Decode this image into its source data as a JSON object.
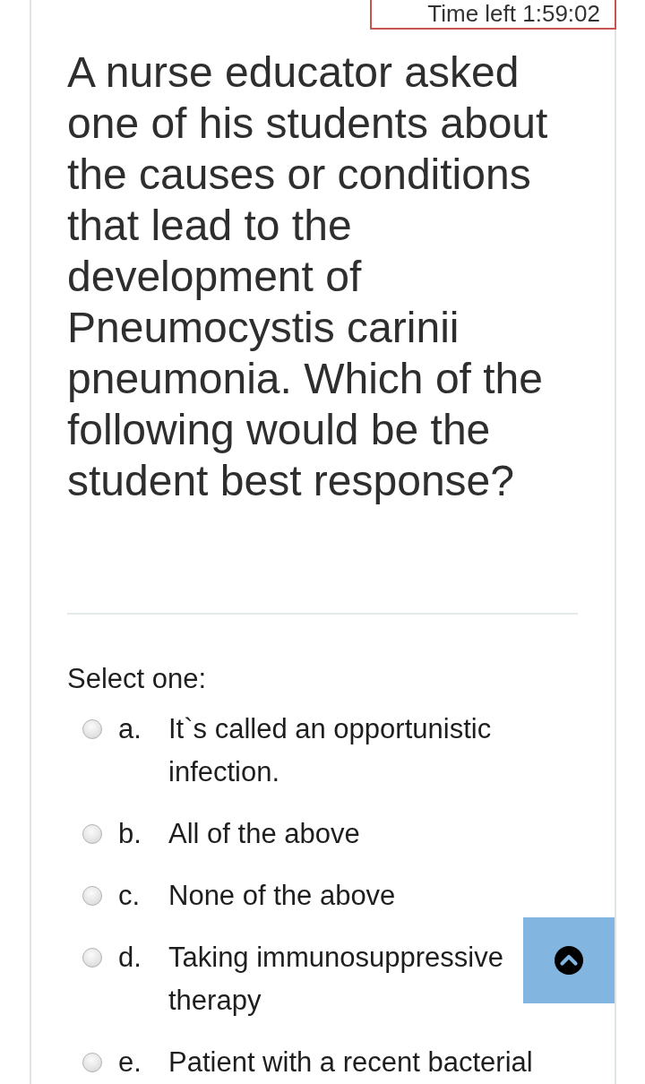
{
  "timer": {
    "text": "Time left 1:59:02"
  },
  "question": {
    "text": "A nurse educator asked one of his students about the causes or conditions that lead to the development of Pneumocystis carinii pneumonia. Which of the following would be the student best response?"
  },
  "prompt": "Select one:",
  "options": [
    {
      "letter": "a.",
      "text": "It`s called an opportunistic infection.",
      "selected": false
    },
    {
      "letter": "b.",
      "text": "All of the above",
      "selected": false
    },
    {
      "letter": "c.",
      "text": "None of the above",
      "selected": false
    },
    {
      "letter": "d.",
      "text": "Taking immunosuppressive therapy",
      "selected": false
    },
    {
      "letter": "e.",
      "text": "Patient with a recent bacterial",
      "selected": false
    }
  ]
}
